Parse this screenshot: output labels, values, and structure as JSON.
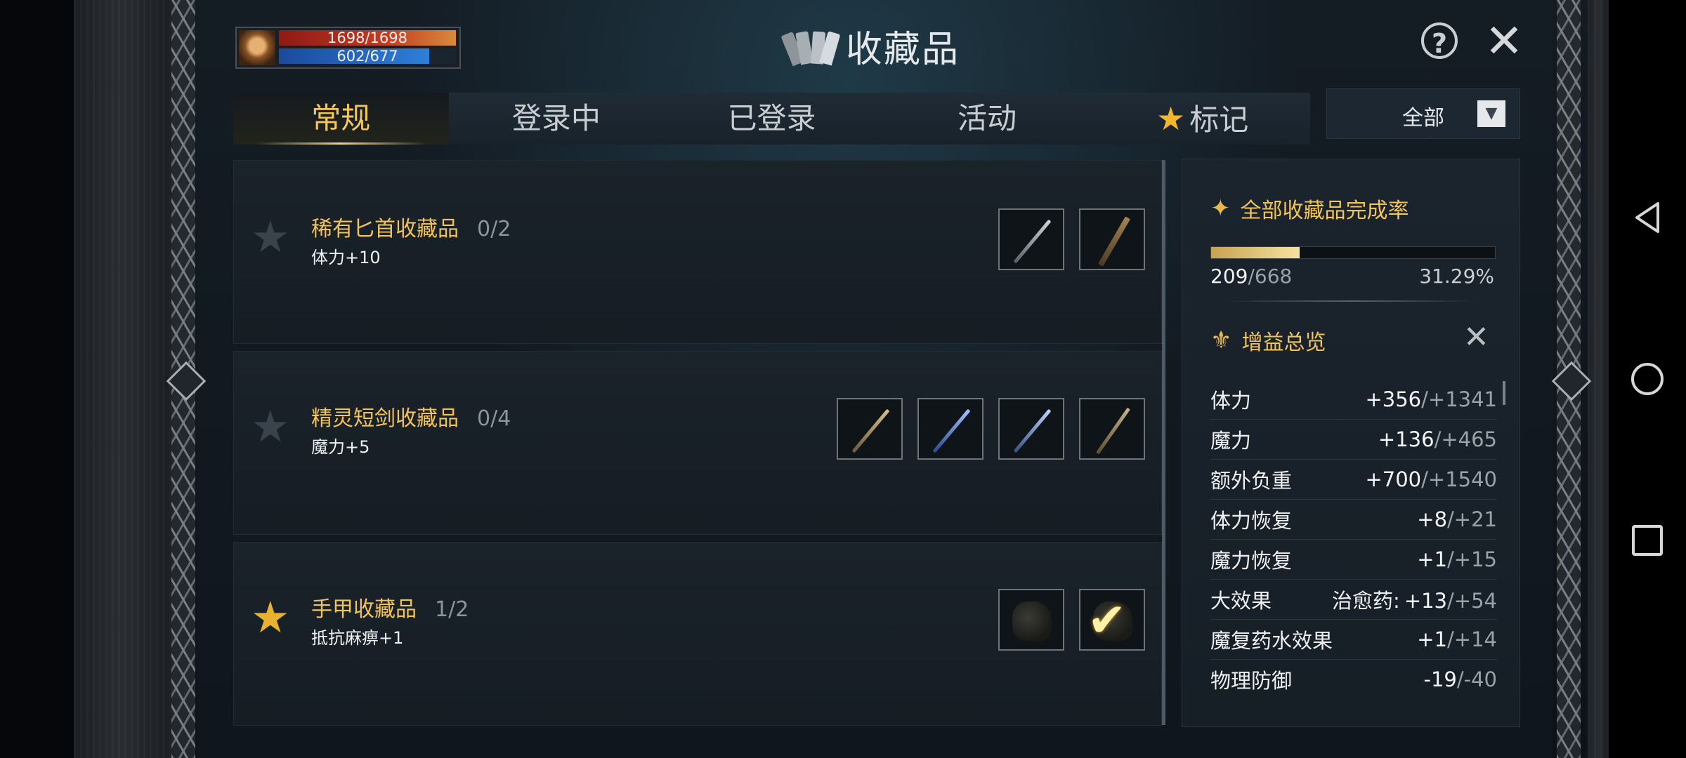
{
  "player": {
    "hp": "1698/1698",
    "mp": "602/677"
  },
  "window": {
    "title": "收藏品"
  },
  "tabs": [
    {
      "label": "常规",
      "active": true
    },
    {
      "label": "登录中",
      "active": false
    },
    {
      "label": "已登录",
      "active": false
    },
    {
      "label": "活动",
      "active": false
    },
    {
      "label": "标记",
      "active": false,
      "icon": "star-icon"
    }
  ],
  "filter": {
    "selected": "全部"
  },
  "collections": [
    {
      "name": "稀有匕首收藏品",
      "progress": "0/2",
      "bonus": "体力+10",
      "starred": false,
      "items": [
        {
          "icon": "dagger-icon",
          "collected": false
        },
        {
          "icon": "curved-dagger-icon",
          "collected": false
        }
      ]
    },
    {
      "name": "精灵短剑收藏品",
      "progress": "0/4",
      "bonus": "魔力+5",
      "starred": false,
      "items": [
        {
          "icon": "short-sword-icon",
          "collected": false
        },
        {
          "icon": "short-sword-icon",
          "collected": false
        },
        {
          "icon": "short-sword-icon",
          "collected": false
        },
        {
          "icon": "curved-sword-icon",
          "collected": false
        }
      ]
    },
    {
      "name": "手甲收藏品",
      "progress": "1/2",
      "bonus": "抵抗麻痹+1",
      "starred": true,
      "items": [
        {
          "icon": "gauntlet-icon",
          "collected": false
        },
        {
          "icon": "gauntlet-icon",
          "collected": true
        }
      ]
    }
  ],
  "summary": {
    "completion_title": "全部收藏品完成率",
    "collected": "209",
    "total": "/668",
    "percent": "31.29%",
    "progress_fraction": 0.3129,
    "buff_title": "增益总览",
    "stats": [
      {
        "name": "体力",
        "current": "+356",
        "max": "/+1341"
      },
      {
        "name": "魔力",
        "current": "+136",
        "max": "/+465"
      },
      {
        "name": "额外负重",
        "current": "+700",
        "max": "/+1540"
      },
      {
        "name": "体力恢复",
        "current": "+8",
        "max": "/+21"
      },
      {
        "name": "魔力恢复",
        "current": "+1",
        "max": "/+15"
      },
      {
        "name": "大效果",
        "extra": "治愈药:",
        "current": "+13",
        "max": "/+54"
      },
      {
        "name": "魔复药水效果",
        "current": "+1",
        "max": "/+14"
      },
      {
        "name": "物理防御",
        "current": "-19",
        "max": "/-40"
      }
    ]
  },
  "colors": {
    "accent_gold": "#f2c45a",
    "star_gold": "#e9b22e",
    "hp": "#c33b22",
    "mp": "#2e7fd9"
  }
}
